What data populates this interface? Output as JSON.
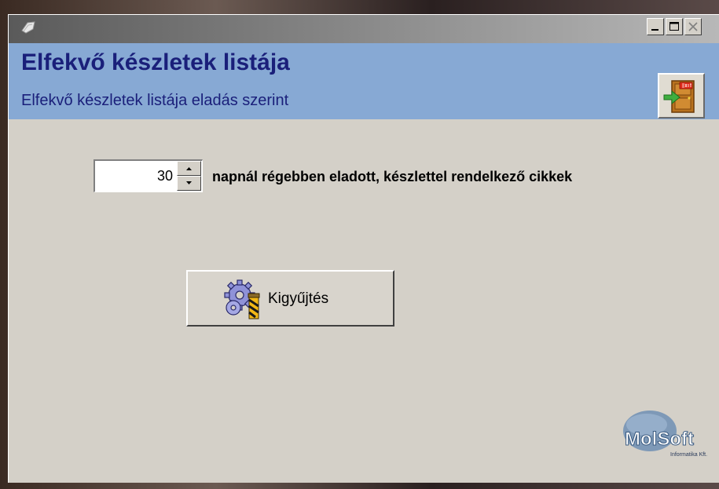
{
  "window": {
    "title": ""
  },
  "header": {
    "title": "Elfekvő készletek listája",
    "subtitle": "Elfekvő készletek listája eladás szerint"
  },
  "filter": {
    "days_value": "30",
    "days_label": "napnál régebben eladott, készlettel rendelkező cikkek"
  },
  "actions": {
    "collect_label": "Kigyűjtés"
  },
  "brand": {
    "logo_text": "MolSoft",
    "logo_subtext": "Informatika Kft."
  },
  "icons": [
    "app-icon",
    "minimize-icon",
    "maximize-icon",
    "close-icon",
    "exit-door-icon",
    "spin-up-icon",
    "spin-down-icon",
    "gears-icon",
    "molsoft-logo"
  ],
  "colors": {
    "header_bg": "#87a9d4",
    "header_text": "#1a1f7a",
    "window_bg": "#d4d0c8"
  }
}
